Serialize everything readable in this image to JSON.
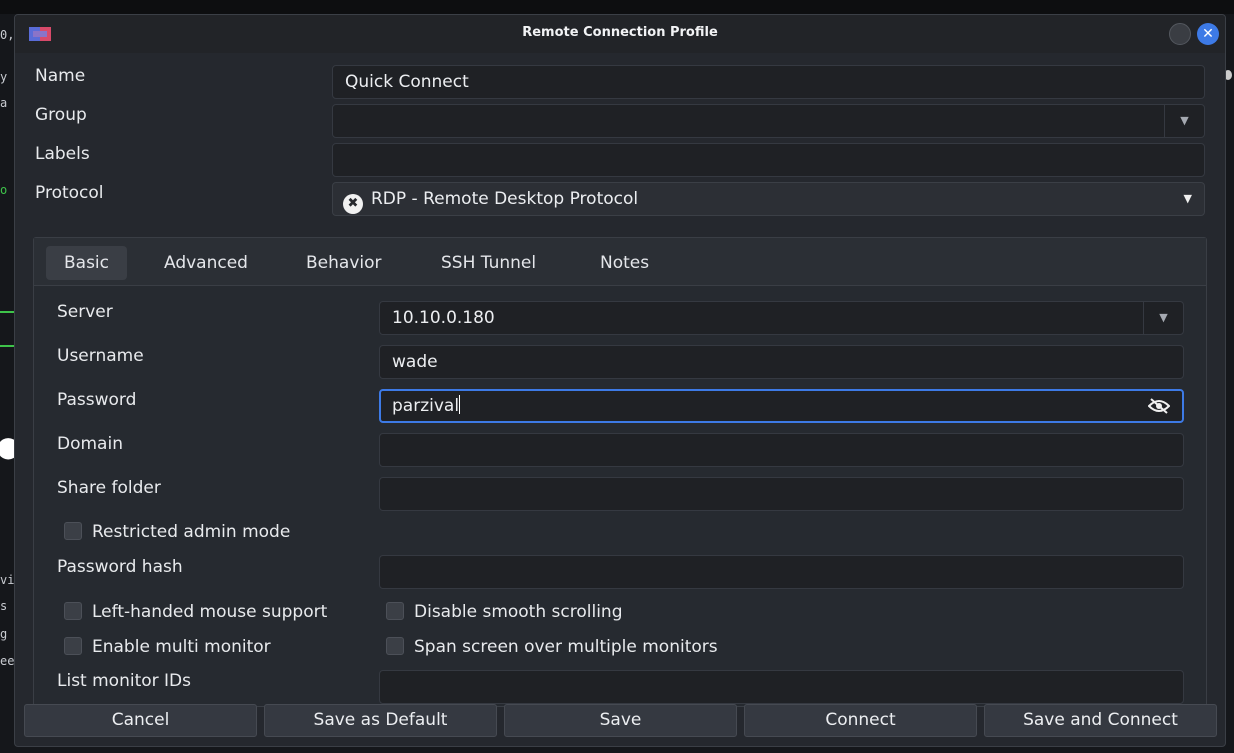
{
  "window": {
    "title": "Remote Connection Profile"
  },
  "background": {
    "fragments": [
      "0,",
      "y",
      "a",
      "o",
      "vi",
      "s",
      "g",
      "ee"
    ]
  },
  "profile": {
    "name_label": "Name",
    "name_value": "Quick Connect",
    "group_label": "Group",
    "group_value": "",
    "labels_label": "Labels",
    "labels_value": "",
    "protocol_label": "Protocol",
    "protocol_value": "RDP - Remote Desktop Protocol"
  },
  "tabs": [
    {
      "label": "Basic",
      "active": true
    },
    {
      "label": "Advanced",
      "active": false
    },
    {
      "label": "Behavior",
      "active": false
    },
    {
      "label": "SSH Tunnel",
      "active": false
    },
    {
      "label": "Notes",
      "active": false
    }
  ],
  "basic": {
    "server_label": "Server",
    "server_value": "10.10.0.180",
    "username_label": "Username",
    "username_value": "wade",
    "password_label": "Password",
    "password_value": "parzival",
    "domain_label": "Domain",
    "domain_value": "",
    "share_label": "Share folder",
    "share_value": "",
    "restricted_label": "Restricted admin mode",
    "hash_label": "Password hash",
    "hash_value": "",
    "left_handed_label": "Left-handed mouse support",
    "disable_smooth_label": "Disable smooth scrolling",
    "multi_monitor_label": "Enable multi monitor",
    "span_label": "Span screen over multiple monitors",
    "monitor_ids_label": "List monitor IDs",
    "monitor_ids_value": ""
  },
  "buttons": {
    "cancel": "Cancel",
    "save_default": "Save as Default",
    "save": "Save",
    "connect": "Connect",
    "save_connect": "Save and Connect"
  },
  "colors": {
    "accent": "#3d7ae6",
    "background": "#25282e",
    "field": "#1f2125"
  }
}
